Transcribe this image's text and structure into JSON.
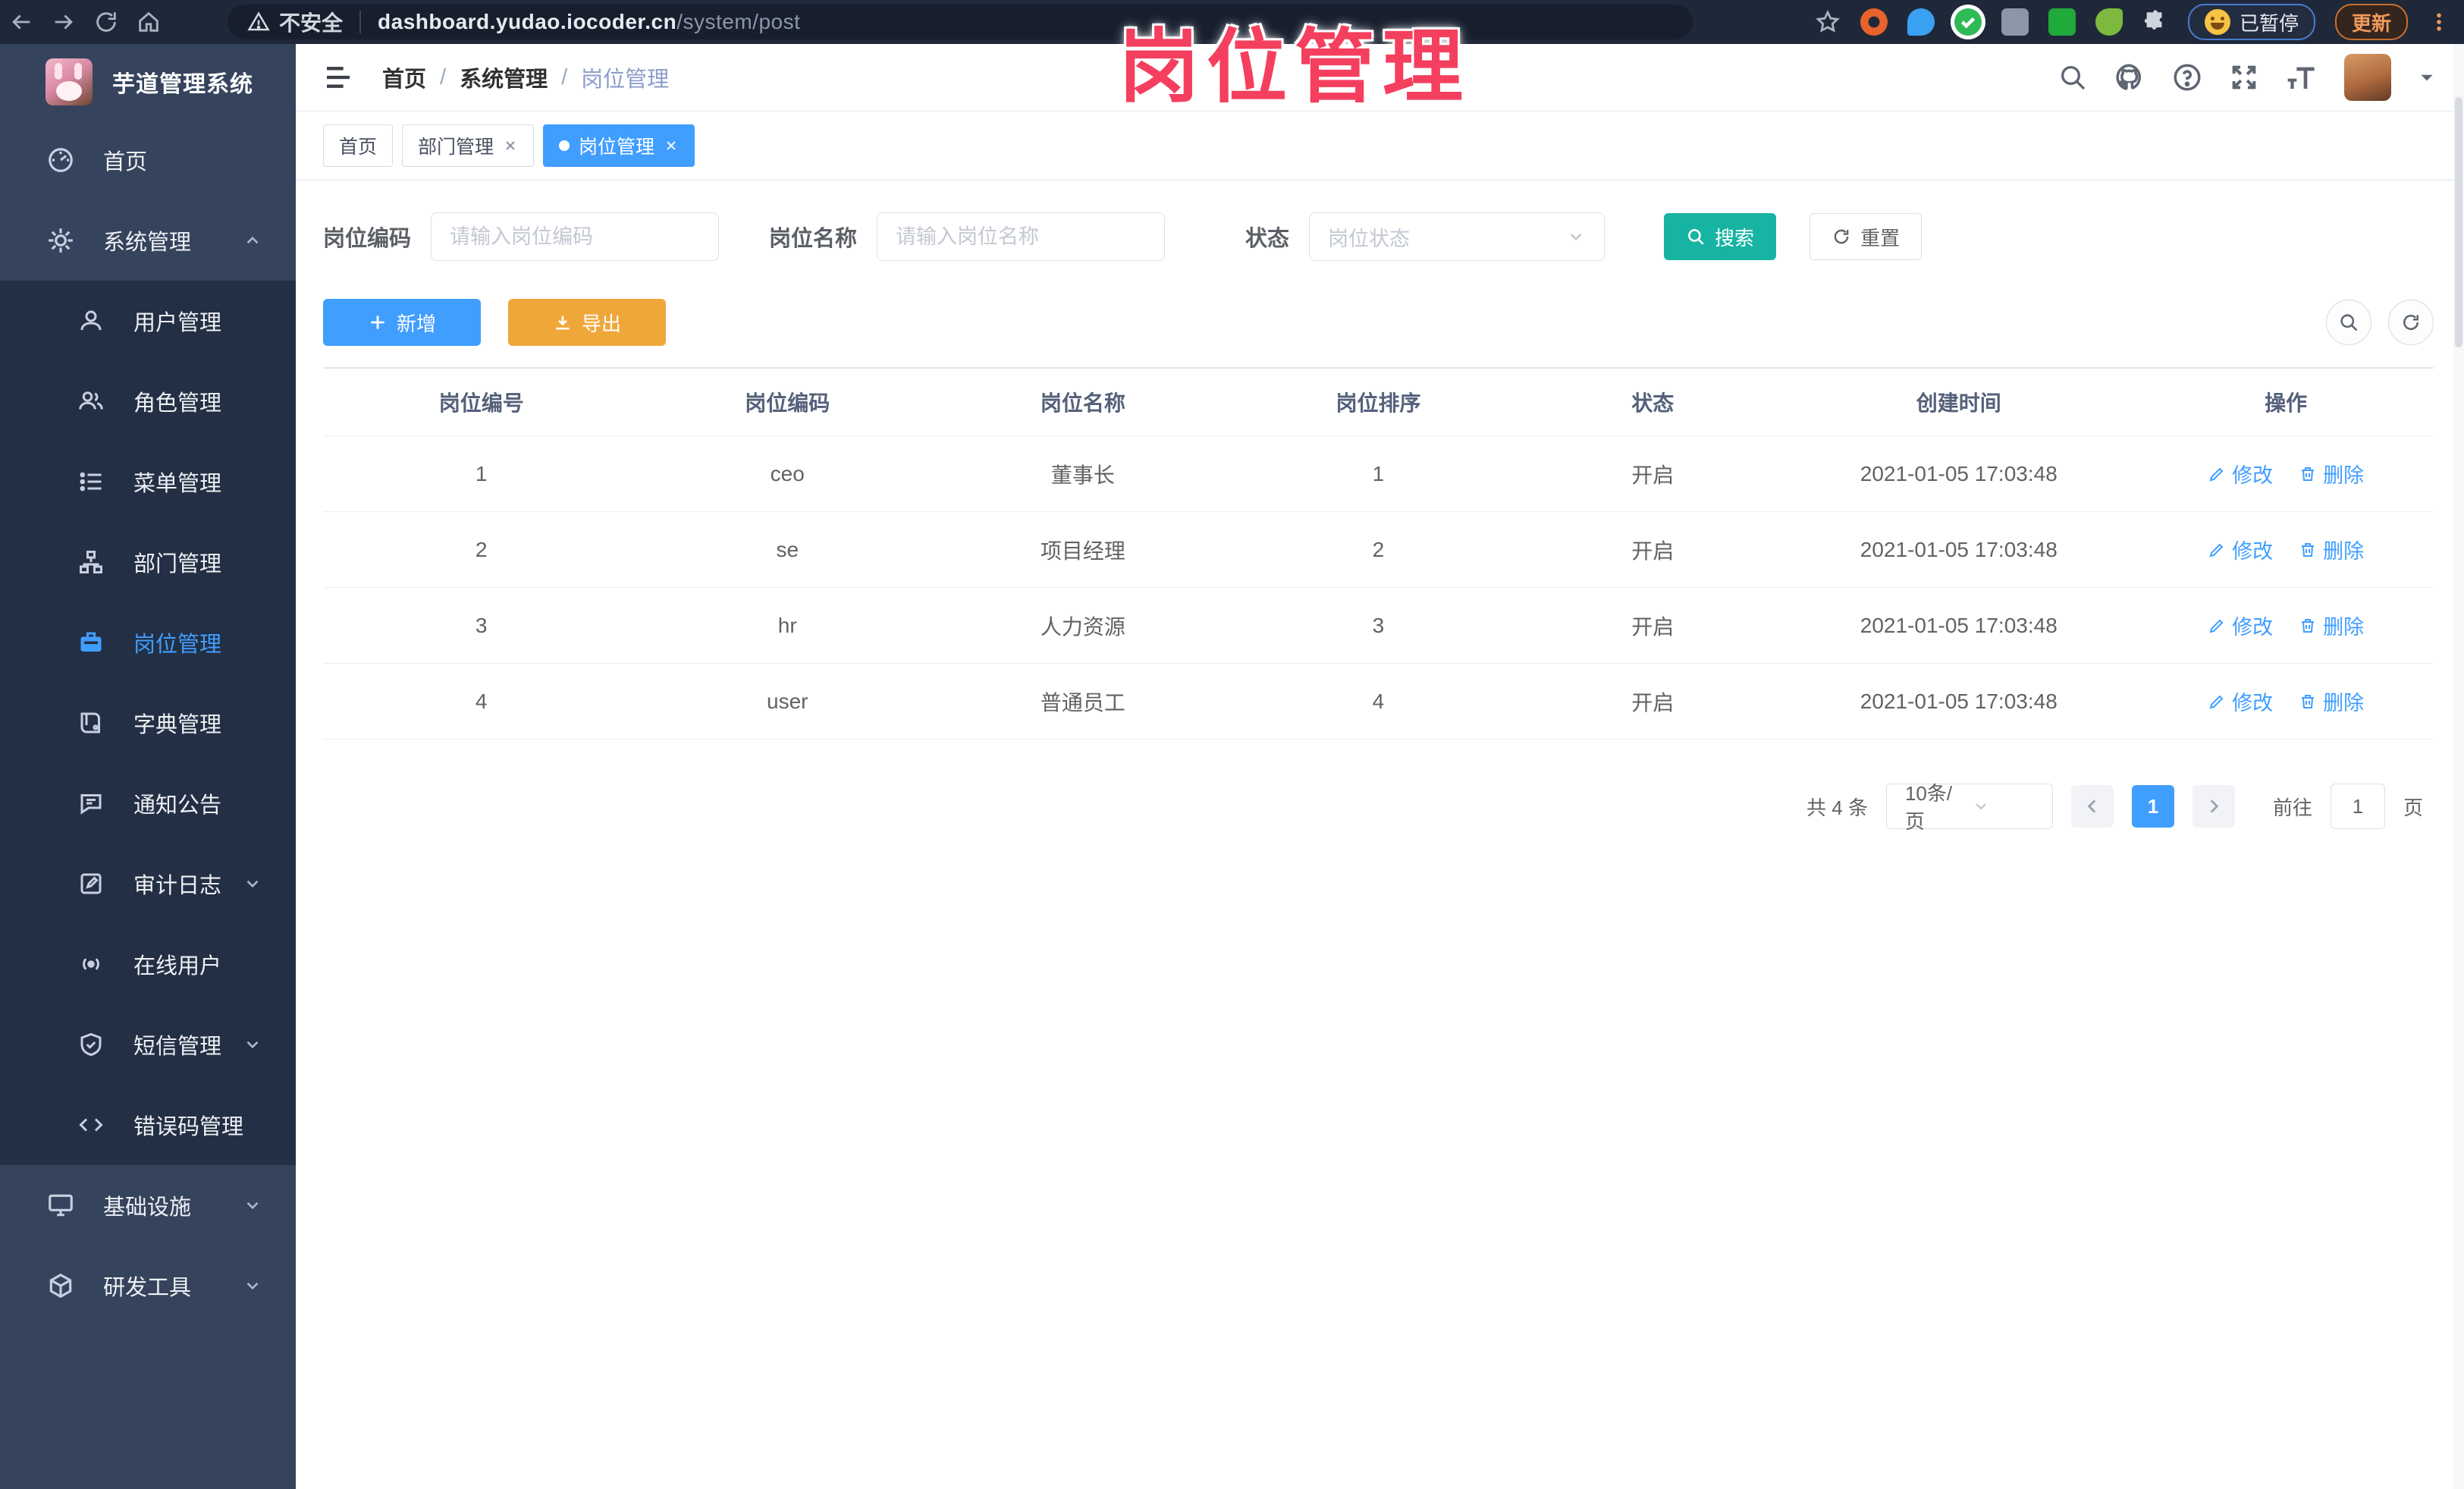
{
  "annotation": {
    "title": "岗位管理"
  },
  "browser": {
    "security_label": "不安全",
    "url_host": "dashboard.yudao.iocoder.cn",
    "url_path": "/system/post",
    "paused_label": "已暂停",
    "update_label": "更新"
  },
  "sidebar": {
    "app_title": "芋道管理系统",
    "home": {
      "label": "首页"
    },
    "system": {
      "label": "系统管理"
    },
    "system_children": [
      {
        "label": "用户管理"
      },
      {
        "label": "角色管理"
      },
      {
        "label": "菜单管理"
      },
      {
        "label": "部门管理"
      },
      {
        "label": "岗位管理"
      },
      {
        "label": "字典管理"
      },
      {
        "label": "通知公告"
      },
      {
        "label": "审计日志"
      },
      {
        "label": "在线用户"
      },
      {
        "label": "短信管理"
      },
      {
        "label": "错误码管理"
      }
    ],
    "infra": {
      "label": "基础设施"
    },
    "tools": {
      "label": "研发工具"
    }
  },
  "header": {
    "breadcrumb": [
      "首页",
      "系统管理",
      "岗位管理"
    ]
  },
  "tabs": [
    {
      "label": "首页"
    },
    {
      "label": "部门管理"
    },
    {
      "label": "岗位管理"
    }
  ],
  "filters": {
    "post_code_label": "岗位编码",
    "post_code_placeholder": "请输入岗位编码",
    "post_name_label": "岗位名称",
    "post_name_placeholder": "请输入岗位名称",
    "status_label": "状态",
    "status_placeholder": "岗位状态",
    "search_label": "搜索",
    "reset_label": "重置"
  },
  "toolbar": {
    "add_label": "新增",
    "export_label": "导出"
  },
  "table": {
    "headers": [
      "岗位编号",
      "岗位编码",
      "岗位名称",
      "岗位排序",
      "状态",
      "创建时间",
      "操作"
    ],
    "edit_label": "修改",
    "delete_label": "删除",
    "rows": [
      {
        "id": "1",
        "code": "ceo",
        "name": "董事长",
        "sort": "1",
        "status": "开启",
        "created": "2021-01-05 17:03:48"
      },
      {
        "id": "2",
        "code": "se",
        "name": "项目经理",
        "sort": "2",
        "status": "开启",
        "created": "2021-01-05 17:03:48"
      },
      {
        "id": "3",
        "code": "hr",
        "name": "人力资源",
        "sort": "3",
        "status": "开启",
        "created": "2021-01-05 17:03:48"
      },
      {
        "id": "4",
        "code": "user",
        "name": "普通员工",
        "sort": "4",
        "status": "开启",
        "created": "2021-01-05 17:03:48"
      }
    ]
  },
  "pagination": {
    "total": "共 4 条",
    "size": "10条/页",
    "page": "1",
    "goto_label": "前往",
    "goto_value": "1",
    "unit_label": "页"
  },
  "colors": {
    "primary": "#409eff",
    "search_teal": "#17b3a3",
    "export_orange": "#f0a73a",
    "annotation_pink": "#f43f5e"
  }
}
